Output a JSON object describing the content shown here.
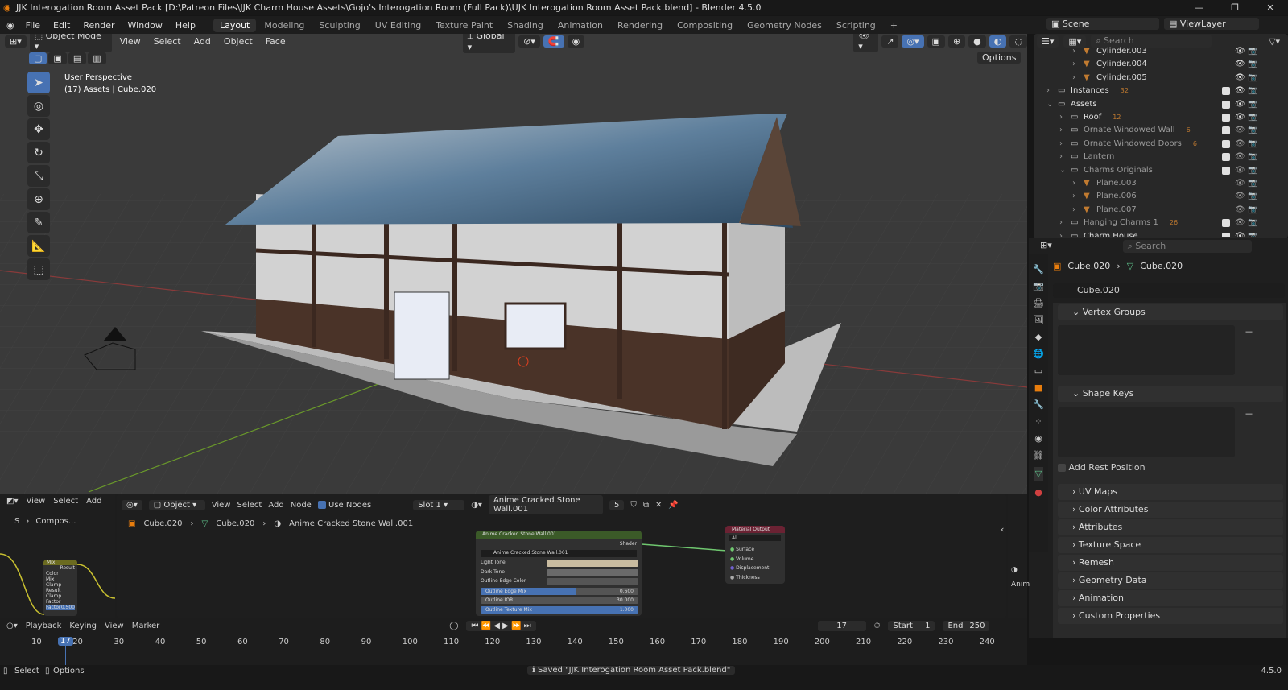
{
  "window": {
    "title": "JJK Interogation Room Asset Pack [D:\\Patreon Files\\JJK Charm House Assets\\Gojo's Interogation Room (Full Pack)\\UJK Interogation Room Asset Pack.blend] - Blender 4.5.0",
    "min": "—",
    "max": "❐",
    "close": "✕"
  },
  "menu": [
    "File",
    "Edit",
    "Render",
    "Window",
    "Help"
  ],
  "workspaces": [
    "Layout",
    "Modeling",
    "Sculpting",
    "UV Editing",
    "Texture Paint",
    "Shading",
    "Animation",
    "Rendering",
    "Compositing",
    "Geometry Nodes",
    "Scripting",
    "+"
  ],
  "viewport": {
    "mode": "Object Mode",
    "menus": [
      "View",
      "Select",
      "Add",
      "Object",
      "Face"
    ],
    "orientation": "Global",
    "options": "Options",
    "overlay_line1": "User Perspective",
    "overlay_line2": "(17) Assets | Cube.020"
  },
  "topright": {
    "scene": "Scene",
    "viewlayer": "ViewLayer"
  },
  "outliner": {
    "search_placeholder": "Search",
    "rows": [
      {
        "label": "Cylinder.003",
        "indent": 3,
        "type": "mesh"
      },
      {
        "label": "Cylinder.004",
        "indent": 3,
        "type": "mesh"
      },
      {
        "label": "Cylinder.005",
        "indent": 3,
        "type": "mesh"
      },
      {
        "label": "Instances",
        "indent": 1,
        "type": "collection",
        "badge": "32"
      },
      {
        "label": "Assets",
        "indent": 1,
        "type": "collection",
        "open": true
      },
      {
        "label": "Roof",
        "indent": 2,
        "type": "collection",
        "badge": "12"
      },
      {
        "label": "Ornate Windowed Wall",
        "indent": 2,
        "type": "collection",
        "badge": "6",
        "dim": true
      },
      {
        "label": "Ornate Windowed Doors",
        "indent": 2,
        "type": "collection",
        "badge": "6",
        "dim": true
      },
      {
        "label": "Lantern",
        "indent": 2,
        "type": "collection",
        "dim": true
      },
      {
        "label": "Charms Originals",
        "indent": 2,
        "type": "collection",
        "open": true,
        "dim": true
      },
      {
        "label": "Plane.003",
        "indent": 3,
        "type": "mesh",
        "dim": true
      },
      {
        "label": "Plane.006",
        "indent": 3,
        "type": "mesh",
        "dim": true
      },
      {
        "label": "Plane.007",
        "indent": 3,
        "type": "mesh",
        "dim": true
      },
      {
        "label": "Hanging Charms 1",
        "indent": 2,
        "type": "collection",
        "badge": "26",
        "dim": true
      },
      {
        "label": "Charm House",
        "indent": 2,
        "type": "collection"
      }
    ]
  },
  "properties": {
    "search_placeholder": "Search",
    "breadcrumb_object": "Cube.020",
    "breadcrumb_mesh": "Cube.020",
    "mesh_name": "Cube.020",
    "vertex_groups": "Vertex Groups",
    "shape_keys": "Shape Keys",
    "add_rest_position": "Add Rest Position",
    "panels": [
      "UV Maps",
      "Color Attributes",
      "Attributes",
      "Texture Space",
      "Remesh",
      "Geometry Data",
      "Animation",
      "Custom Properties"
    ]
  },
  "nodes_left": {
    "menus": [
      "View",
      "Select",
      "Add"
    ],
    "crumb1": "S",
    "crumb2": "Compos..."
  },
  "node_editor": {
    "type": "Object",
    "menus": [
      "View",
      "Select",
      "Add",
      "Node"
    ],
    "use_nodes": "Use Nodes",
    "slot": "Slot 1",
    "material": "Anime Cracked Stone Wall.001",
    "users": "5",
    "crumb_object": "Cube.020",
    "crumb_mesh": "Cube.020",
    "crumb_material": "Anime Cracked Stone Wall.001",
    "group_node": {
      "title": "Anime Cracked Stone Wall.001",
      "output": "Shader",
      "datablock": "Anime Cracked Stone Wall.001",
      "inputs": [
        {
          "label": "Light Tone",
          "color": "#c9bca0"
        },
        {
          "label": "Dark Tone",
          "color": "#6a6a6a"
        },
        {
          "label": "Outline Edge Color",
          "color": "#555555"
        }
      ],
      "sliders": [
        {
          "label": "Outline Edge Mix",
          "value": "0.600",
          "fraction": 0.6
        },
        {
          "label": "Outline IOR",
          "value": "30.000",
          "fraction": 0
        },
        {
          "label": "Outline Texture Mix",
          "value": "1.000",
          "fraction": 1
        }
      ]
    },
    "output_node": {
      "title": "Material Output",
      "target": "All",
      "sockets": [
        "Surface",
        "Volume",
        "Displacement",
        "Thickness"
      ]
    },
    "mix_node": {
      "title": "Mix",
      "result": "Result",
      "type": "Color",
      "blend": "Mix",
      "clamp_result": "Clamp Result",
      "clamp_factor": "Clamp Factor",
      "factor_label": "Factor",
      "factor": "0.500"
    },
    "side_label": "Anim"
  },
  "timeline": {
    "menus": [
      "Playback",
      "Keying",
      "View",
      "Marker"
    ],
    "current_frame": "17",
    "start_label": "Start",
    "start": "1",
    "end_label": "End",
    "end": "250",
    "ticks": [
      "10",
      "20",
      "30",
      "40",
      "50",
      "60",
      "70",
      "80",
      "90",
      "100",
      "110",
      "120",
      "130",
      "140",
      "150",
      "160",
      "170",
      "180",
      "190",
      "200",
      "210",
      "220",
      "230",
      "240"
    ]
  },
  "status": {
    "select": "Select",
    "options": "Options",
    "message": "Saved \"JJK Interogation Room Asset Pack.blend\"",
    "version": "4.5.0"
  },
  "colors": {
    "accent": "#4772b3",
    "node_group_header": "#3b5a28",
    "material_output_header": "#6b2233",
    "link": "#6fc76f"
  }
}
